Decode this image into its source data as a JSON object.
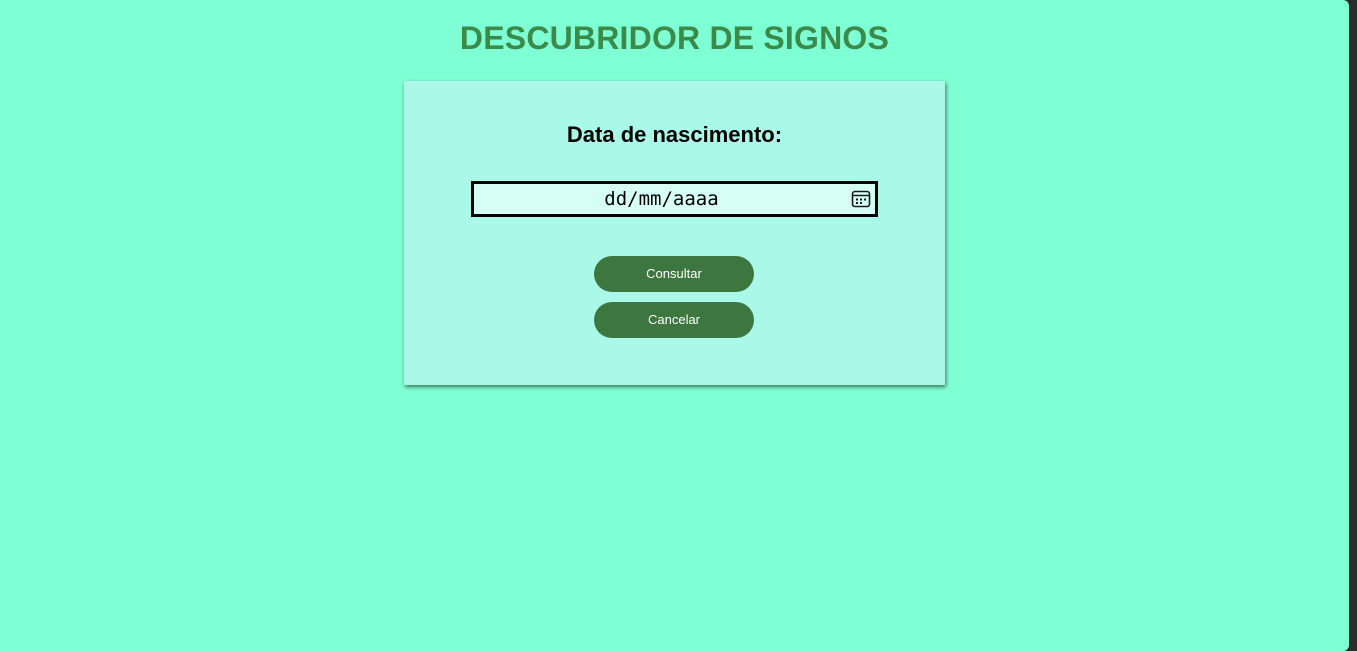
{
  "page": {
    "title": "DESCUBRIDOR DE SIGNOS"
  },
  "form": {
    "heading": "Data de nascimento:",
    "date_placeholder": "dd/mm/aaaa",
    "date_value": "",
    "calendar_icon": "calendar-icon",
    "buttons": {
      "submit_label": "Consultar",
      "cancel_label": "Cancelar"
    }
  },
  "colors": {
    "background": "#7fffd4",
    "card": "#aaf8e8",
    "title": "#3c8a4a",
    "button": "#3d763f",
    "input_bg": "#d6fff3"
  }
}
